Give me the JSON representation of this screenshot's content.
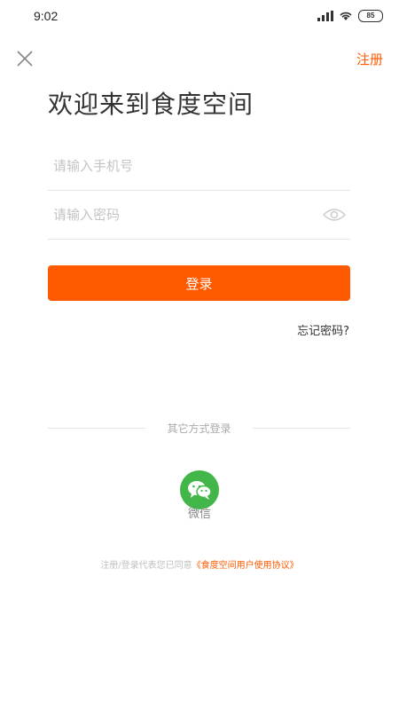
{
  "status_bar": {
    "time": "9:02",
    "battery": "85",
    "signal_icon": "signal-icon",
    "wifi_icon": "wifi-icon"
  },
  "header": {
    "close_icon": "close-icon",
    "register_label": "注册"
  },
  "welcome": {
    "title": "欢迎来到食度空间"
  },
  "form": {
    "phone_placeholder": "请输入手机号",
    "password_placeholder": "请输入密码",
    "eye_icon": "eye-icon",
    "login_label": "登录",
    "forgot_label": "忘记密码?"
  },
  "other_login": {
    "label": "其它方式登录",
    "wechat_label": "微信",
    "wechat_icon": "wechat-icon"
  },
  "agreement": {
    "prefix": "注册/登录代表您已同意",
    "link": "《食度空间用户使用协议》"
  },
  "colors": {
    "accent": "#ff5a00",
    "wechat": "#43b649"
  }
}
